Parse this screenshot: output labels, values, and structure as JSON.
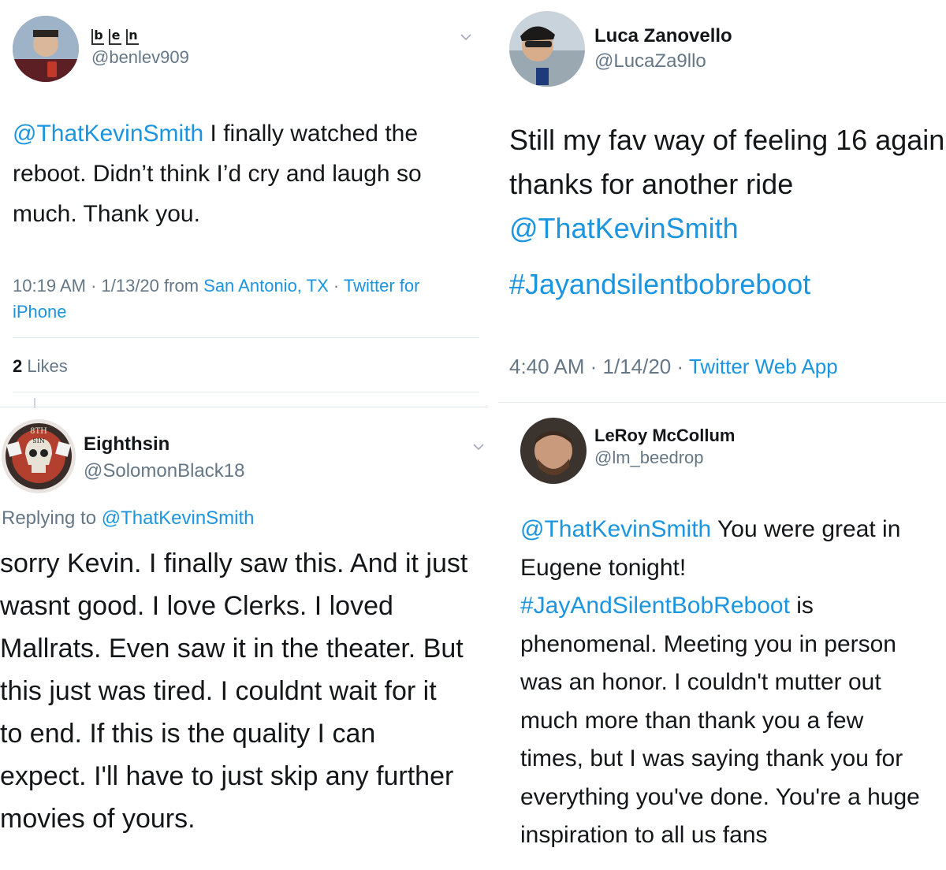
{
  "tweets": {
    "ben": {
      "name_letters": [
        "b",
        "e",
        "n"
      ],
      "handle": "@benlev909",
      "mention": "@ThatKevinSmith",
      "text": " I finally watched the reboot. Didn’t think I’d cry and laugh so much. Thank you.",
      "time": "10:19 AM · 1/13/20 from ",
      "location": "San Antonio, TX",
      "sep": " · ",
      "source": "Twitter for iPhone",
      "likes_count": "2",
      "likes_label": " Likes"
    },
    "luca": {
      "name": "Luca Zanovello",
      "handle": "@LucaZa9llo",
      "line1": "Still my fav way of feeling 16 again",
      "line2": "thanks for another ride",
      "mention": "@ThatKevinSmith",
      "hashtag": "#Jayandsilentbobreboot",
      "time": "4:40 AM · 1/14/20 · ",
      "source": "Twitter Web App"
    },
    "eighth": {
      "name": "Eighthsin",
      "handle": "@SolomonBlack18",
      "avatar_text_top": "8TH",
      "avatar_text_bottom": "SIN",
      "replying_label": "Replying to ",
      "replying_to": "@ThatKevinSmith",
      "lines": [
        "sorry Kevin. I finally saw this. And it just",
        "wasnt good. I love Clerks. I loved",
        "Mallrats. Even saw it in the theater. But",
        "this just was tired. I couldnt wait for it",
        "to end. If this is the quality I can",
        "expect. I'll have to just skip any further",
        "movies of yours."
      ]
    },
    "leroy": {
      "name": "LeRoy McCollum",
      "handle": "@lm_beedrop",
      "mention": "@ThatKevinSmith",
      "line1_rest": " You were great in",
      "line2": "Eugene tonight!",
      "hashtag": "#JayAndSilentBobReboot",
      "line3_rest": " is",
      "lines": [
        "phenomenal. Meeting you in person",
        "was an honor. I couldn't mutter out",
        "much more than thank you a few",
        "times, but I was saying thank you for",
        "everything you've done. You're a huge",
        "inspiration to all us fans"
      ]
    }
  },
  "colors": {
    "link": "#1b95e0",
    "muted": "#657786",
    "rule": "#e1e8ed"
  }
}
